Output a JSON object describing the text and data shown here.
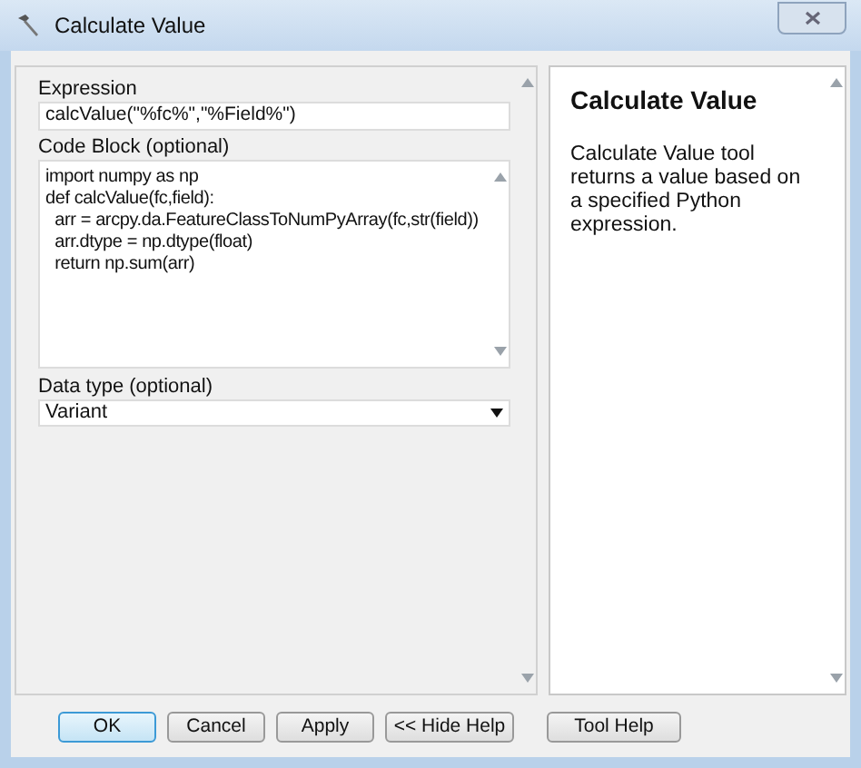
{
  "window": {
    "title": "Calculate Value"
  },
  "form": {
    "expression": {
      "label": "Expression",
      "value": "calcValue(\"%fc%\",\"%Field%\")"
    },
    "code_block": {
      "label": "Code Block (optional)",
      "lines": [
        "import numpy as np",
        "def calcValue(fc,field):",
        "  arr = arcpy.da.FeatureClassToNumPyArray(fc,str(field))",
        "  arr.dtype = np.dtype(float)",
        "  return np.sum(arr)"
      ]
    },
    "data_type": {
      "label": "Data type (optional)",
      "value": "Variant"
    }
  },
  "help": {
    "title": "Calculate Value",
    "text": "Calculate Value tool returns a value based on a specified Python expression."
  },
  "buttons": [
    {
      "label": "OK",
      "default": true
    },
    {
      "label": "Cancel",
      "default": false
    },
    {
      "label": "Apply",
      "default": false
    },
    {
      "label": "<< Hide Help",
      "default": false
    },
    {
      "label": "Tool Help",
      "default": false
    }
  ]
}
